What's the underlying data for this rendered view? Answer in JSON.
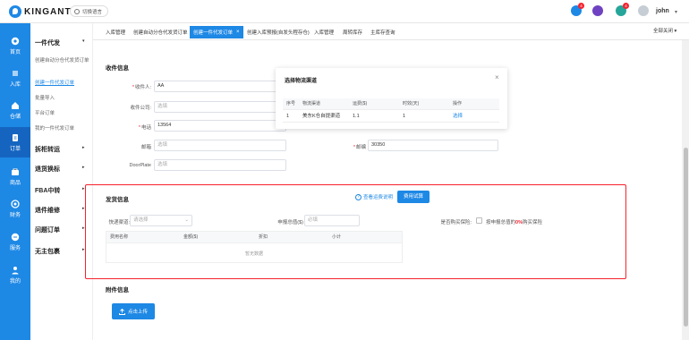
{
  "header": {
    "logo_text": "KINGANT",
    "lang_button": "切换语言",
    "notification_badges": [
      "4",
      "4"
    ],
    "user_name": "john"
  },
  "sidebar": {
    "items": [
      {
        "label": "首页",
        "icon": "home-icon"
      },
      {
        "label": "入库",
        "icon": "inbound-icon"
      },
      {
        "label": "仓储",
        "icon": "warehouse-icon"
      },
      {
        "label": "订单",
        "icon": "order-icon",
        "active": true
      },
      {
        "label": "商品",
        "icon": "product-icon"
      },
      {
        "label": "财务",
        "icon": "finance-icon"
      },
      {
        "label": "服务",
        "icon": "service-icon"
      },
      {
        "label": "我的",
        "icon": "user-icon"
      }
    ]
  },
  "submenu": {
    "groups": [
      {
        "label": "一件代发"
      },
      {
        "label": "拆柜转运"
      },
      {
        "label": "退货换标"
      },
      {
        "label": "FBA中转"
      },
      {
        "label": "退件维修"
      },
      {
        "label": "问题订单"
      },
      {
        "label": "无主包裹"
      }
    ],
    "items": [
      "创建自动分仓代发货订单",
      "创建一件代发订单",
      "批量导入",
      "平台订单",
      "我的一件代发订单"
    ]
  },
  "tabs": [
    {
      "label": "入库管理"
    },
    {
      "label": "创建自动分仓代发货订单"
    },
    {
      "label": "创建一件代发订单",
      "active": true
    },
    {
      "label": "创建入库预报(自发头程存仓)"
    },
    {
      "label": "入库管理"
    },
    {
      "label": "周转库存"
    },
    {
      "label": "主库存查询"
    }
  ],
  "close_all": "全部关闭",
  "receiver": {
    "title": "收件信息",
    "name_label": "收件人:",
    "name_value": "AA",
    "company_label": "收件公司:",
    "company_placeholder": "选填",
    "phone_label": "电话",
    "phone_value": "13564",
    "email_label": "邮箱",
    "email_placeholder": "选填",
    "zip_label": "邮编",
    "zip_value": "30350",
    "doorplate_label": "DoorPlate",
    "doorplate_placeholder": "选填"
  },
  "popup": {
    "title": "选择物流渠道",
    "columns": [
      "序号",
      "物流渠道",
      "运费($)",
      "时效(天)",
      "操作"
    ],
    "row": [
      "1",
      "美东K仓自提渠道",
      "1.1",
      "1",
      "选择"
    ]
  },
  "shipping": {
    "title": "发货信息",
    "fee_link": "查看运费说明",
    "fee_button": "费用试算",
    "channel_label": "快递渠道:",
    "channel_placeholder": "请选择",
    "declared_label": "申报总值($)",
    "declared_placeholder": "必填",
    "insurance_label": "是否购买保险:",
    "insurance_text": "按申报总值的",
    "insurance_pct": "0%",
    "insurance_tail": "购买保险",
    "table_columns": [
      "费用名称",
      "金额($)",
      "折扣",
      "小计"
    ],
    "empty_text": "暂无数据"
  },
  "attachment": {
    "title": "附件信息",
    "upload_button": "点击上传"
  }
}
